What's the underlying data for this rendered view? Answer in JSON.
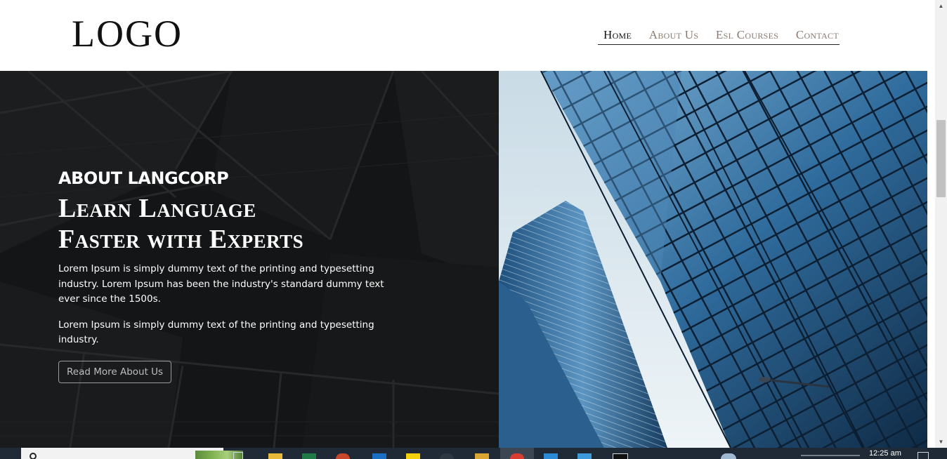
{
  "header": {
    "logo": "LOGO",
    "nav": [
      {
        "label": "Home",
        "active": true
      },
      {
        "label": "About Us",
        "active": false
      },
      {
        "label": "Esl Courses",
        "active": false
      },
      {
        "label": "Contact",
        "active": false
      }
    ]
  },
  "hero": {
    "eyebrow": "ABOUT LANGCORP",
    "headline_line1": "Learn Language",
    "headline_line2": "Faster with Experts",
    "paragraph1": "Lorem Ipsum is simply dummy text of the printing and typesetting industry. Lorem Ipsum has been the industry's standard dummy text ever since the 1500s.",
    "paragraph2": "Lorem Ipsum is simply dummy text of the printing and typesetting industry.",
    "button_label": "Read More About Us"
  },
  "taskbar": {
    "time": "12:25 am"
  },
  "colors": {
    "nav_text": "#8a7a70",
    "nav_active": "#111111",
    "hero_dark": "#151617",
    "sky": "#d9e7ef",
    "glass_blue": "#2d6fa8"
  }
}
